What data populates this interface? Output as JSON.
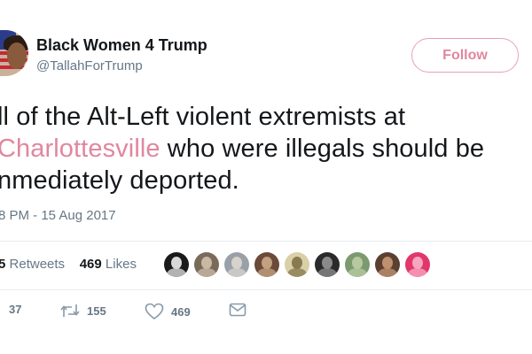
{
  "header": {
    "display_name": "Black Women 4 Trump",
    "handle": "@TallahForTrump",
    "follow_label": "Follow"
  },
  "tweet": {
    "line1": "ll of the Alt-Left violent extremists at",
    "line2_hashtag": "Charlottesville",
    "line2_rest": " who were illegals should be",
    "line3": "nmediately deported.",
    "timestamp": "8 PM - 15 Aug 2017"
  },
  "stats": {
    "retweets_count": "5",
    "retweets_label": "Retweets",
    "likes_count": "469",
    "likes_label": "Likes"
  },
  "likers": [
    {
      "bg": "#1a1a1a",
      "fg": "#d8d8d8"
    },
    {
      "bg": "#7a6a5a",
      "fg": "#c9b8a4"
    },
    {
      "bg": "#9aa0a8",
      "fg": "#d6d2cc"
    },
    {
      "bg": "#6b4a3a",
      "fg": "#c2a080"
    },
    {
      "bg": "#d9cfa8",
      "fg": "#8a7a50"
    },
    {
      "bg": "#2a2a2a",
      "fg": "#8a8a8a"
    },
    {
      "bg": "#7c9a70",
      "fg": "#b8c9a0"
    },
    {
      "bg": "#5a4030",
      "fg": "#c09070"
    },
    {
      "bg": "#e2376a",
      "fg": "#f7a6bf"
    }
  ],
  "actions": {
    "reply_count": "37",
    "retweet_count": "155",
    "like_count": "469"
  },
  "icons": {
    "reply": "reply-icon",
    "retweet": "retweet-icon",
    "like": "heart-icon",
    "message": "direct-message-icon"
  }
}
